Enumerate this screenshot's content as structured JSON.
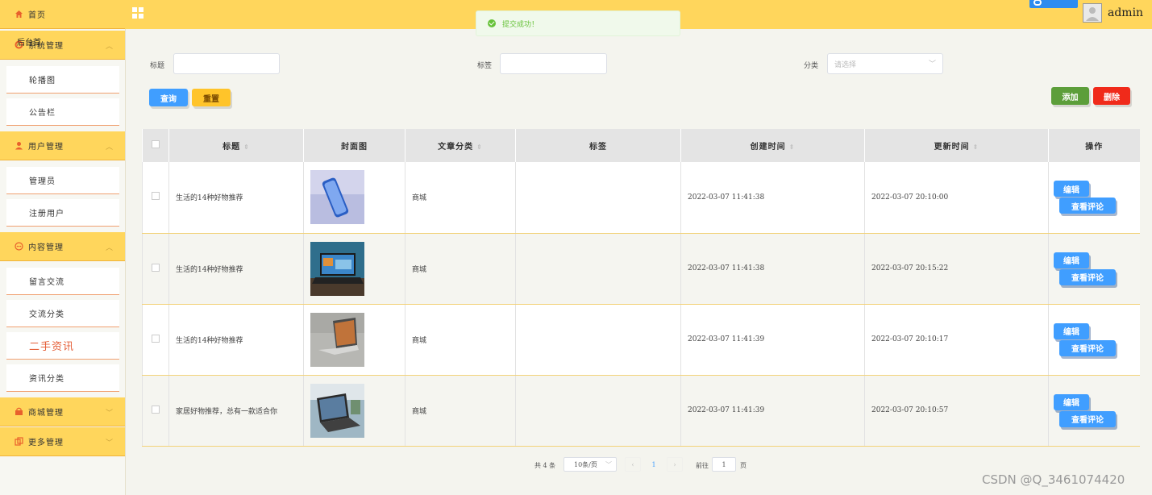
{
  "sidebar": {
    "home": "首页",
    "overlay_label": "后台首",
    "groups": {
      "system": "系统管理",
      "user": "用户管理",
      "content": "内容管理",
      "mall": "商城管理",
      "more": "更多管理"
    },
    "items": {
      "carousel": "轮播图",
      "notice": "公告栏",
      "admin": "管理员",
      "registered": "注册用户",
      "message": "留言交流",
      "exchange_category": "交流分类",
      "secondhand_news": "二手资讯",
      "news_category": "资讯分类"
    }
  },
  "header": {
    "username": "admin"
  },
  "toast": {
    "message": "提交成功！"
  },
  "search": {
    "title_label": "标题",
    "tag_label": "标签",
    "category_label": "分类",
    "category_placeholder": "请选择",
    "query_button": "查询",
    "reset_button": "重置",
    "add_button": "添加",
    "delete_button": "删除"
  },
  "table": {
    "headers": {
      "title": "标题",
      "cover": "封面图",
      "category": "文章分类",
      "tags": "标签",
      "created": "创建时间",
      "updated": "更新时间",
      "actions": "操作"
    },
    "edit_label": "编辑",
    "view_comments_label": "查看评论",
    "rows": [
      {
        "title": "生活的14种好物推荐",
        "cover": "phone-photo",
        "category": "商城",
        "tags": "",
        "created": "2022-03-07 11:41:38",
        "updated": "2022-03-07 20:10:00"
      },
      {
        "title": "生活的14种好物推荐",
        "cover": "laptop-photo",
        "category": "商城",
        "tags": "",
        "created": "2022-03-07 11:41:38",
        "updated": "2022-03-07 20:15:22"
      },
      {
        "title": "生活的14种好物推荐",
        "cover": "laptop-silver-photo",
        "category": "商城",
        "tags": "",
        "created": "2022-03-07 11:41:39",
        "updated": "2022-03-07 20:10:17"
      },
      {
        "title": "家居好物推荐，总有一款适合你",
        "cover": "laptop-desk-photo",
        "category": "商城",
        "tags": "",
        "created": "2022-03-07 11:41:39",
        "updated": "2022-03-07 20:10:57"
      }
    ]
  },
  "pagination": {
    "total": "共 4 条",
    "page_size": "10条/页",
    "current_page": "1",
    "goto_label": "前往",
    "goto_value": "1",
    "page_suffix": "页"
  },
  "watermark": "CSDN @Q_3461074420",
  "colors": {
    "header_bg": "#ffd65c",
    "primary_blue": "#409eff",
    "success_green": "#67c23a",
    "danger_red": "#f02a1a",
    "warning_yellow": "#ffc42a",
    "active_menu_text": "#e5603a"
  }
}
